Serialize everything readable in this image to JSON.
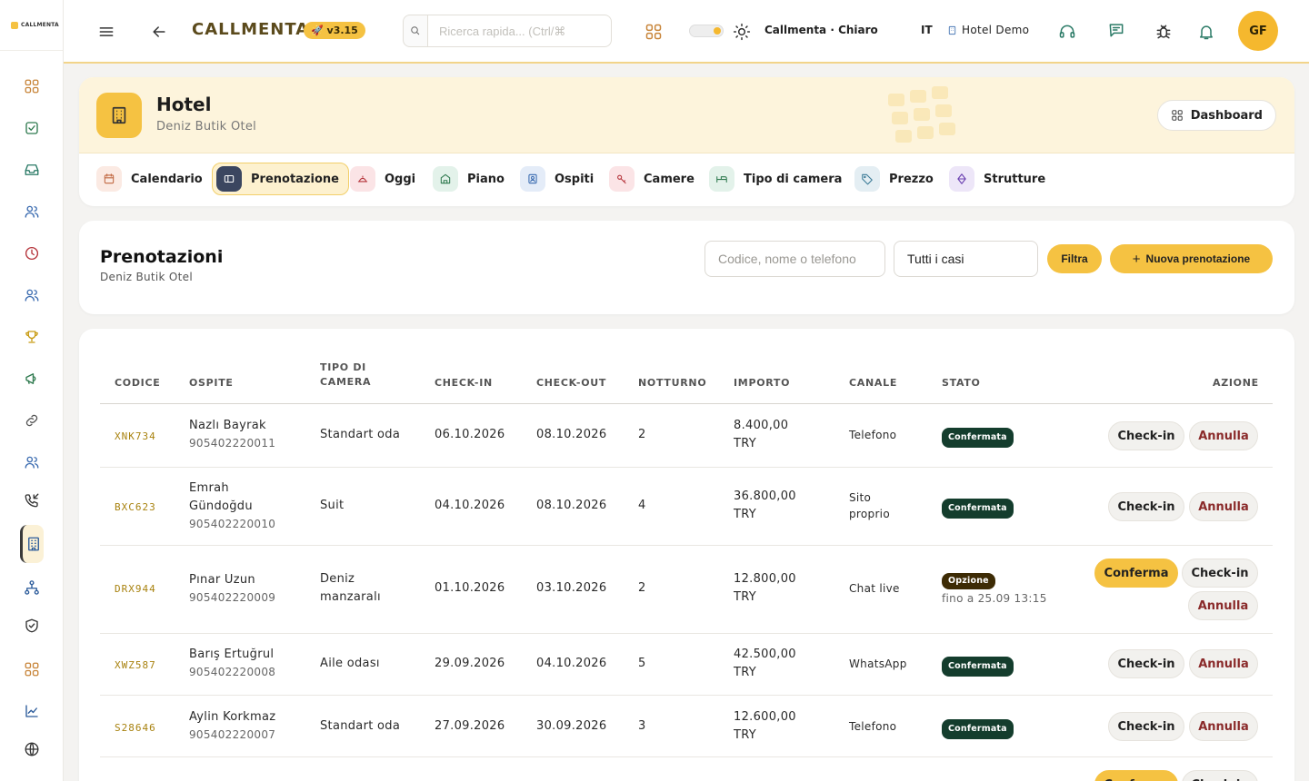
{
  "app": {
    "logo_text": "CALLMENTA",
    "brand": "CALLMENTA",
    "version": "🚀 v3.15",
    "search_placeholder": "Ricerca rapida... (Ctrl/⌘",
    "theme_label": "Callmenta · Chiaro",
    "language": "IT",
    "hotel_name": "Hotel Demo",
    "user_initials": "GF",
    "accent_color": "#f5c242"
  },
  "sidebar": {
    "items": [
      {
        "icon": "grid-icon"
      },
      {
        "icon": "calendar-check-icon"
      },
      {
        "icon": "inbox-icon"
      },
      {
        "icon": "users-icon"
      },
      {
        "icon": "clock-icon"
      },
      {
        "icon": "users-icon"
      },
      {
        "icon": "trophy-icon"
      },
      {
        "icon": "megaphone-icon"
      },
      {
        "icon": "link-icon"
      },
      {
        "icon": "users-icon"
      },
      {
        "icon": "phone-incoming-icon"
      },
      {
        "icon": "building-icon",
        "active": true
      },
      {
        "icon": "hierarchy-icon"
      },
      {
        "icon": "shield-check-icon"
      },
      {
        "icon": "grid-icon"
      },
      {
        "icon": "chart-icon"
      },
      {
        "icon": "globe-icon"
      }
    ]
  },
  "hotel": {
    "title": "Hotel",
    "subtitle": "Deniz Butik Otel",
    "dashboard_label": "Dashboard",
    "tabs": [
      {
        "label": "Calendario",
        "icon": "calendar-icon"
      },
      {
        "label": "Prenotazione",
        "icon": "booking-icon",
        "active": true
      },
      {
        "label": "Oggi",
        "icon": "bell-service-icon"
      },
      {
        "label": "Piano",
        "icon": "floor-icon"
      },
      {
        "label": "Ospiti",
        "icon": "guest-icon"
      },
      {
        "label": "Camere",
        "icon": "key-icon"
      },
      {
        "label": "Tipo di camera",
        "icon": "bed-icon"
      },
      {
        "label": "Prezzo",
        "icon": "tag-icon"
      },
      {
        "label": "Strutture",
        "icon": "gem-icon"
      }
    ]
  },
  "bookings": {
    "title": "Prenotazioni",
    "subtitle": "Deniz Butik Otel",
    "search_placeholder": "Codice, nome o telefono",
    "status_filter": "Tutti i casi",
    "filter_label": "Filtra",
    "new_label": "Nuova prenotazione"
  },
  "table": {
    "headers": {
      "code": "CODICE",
      "guest": "OSPITE",
      "room_type_1": "TIPO DI",
      "room_type_2": "CAMERA",
      "checkin": "CHECK-IN",
      "checkout": "CHECK-OUT",
      "nights": "NOTTURNO",
      "amount": "IMPORTO",
      "channel": "CANALE",
      "status": "STATO",
      "action": "AZIONE"
    },
    "rows": [
      {
        "code": "XNK734",
        "guest_1": "Nazlı Bayrak",
        "guest_2": "",
        "phone": "905402220011",
        "room_1": "Standart oda",
        "room_2": "",
        "checkin": "06.10.2026",
        "checkout": "08.10.2026",
        "nights": "2",
        "amount_1": "8.400,00",
        "amount_2": "TRY",
        "channel_1": "Telefono",
        "channel_2": "",
        "status": "Confermata",
        "until": "",
        "a1": "Check-in",
        "a2": "Annulla"
      },
      {
        "code": "BXC623",
        "guest_1": "Emrah",
        "guest_2": "Gündoğdu",
        "phone": "905402220010",
        "room_1": "Suit",
        "room_2": "",
        "checkin": "04.10.2026",
        "checkout": "08.10.2026",
        "nights": "4",
        "amount_1": "36.800,00",
        "amount_2": "TRY",
        "channel_1": "Sito",
        "channel_2": "proprio",
        "status": "Confermata",
        "until": "",
        "a1": "Check-in",
        "a2": "Annulla"
      },
      {
        "code": "DRX944",
        "guest_1": "Pınar Uzun",
        "guest_2": "",
        "phone": "905402220009",
        "room_1": "Deniz",
        "room_2": "manzaralı",
        "checkin": "01.10.2026",
        "checkout": "03.10.2026",
        "nights": "2",
        "amount_1": "12.800,00",
        "amount_2": "TRY",
        "channel_1": "Chat live",
        "channel_2": "",
        "status": "Opzione",
        "until": "fino a 25.09 13:15",
        "a0": "Conferma",
        "a1": "Check-in",
        "a2": "Annulla"
      },
      {
        "code": "XWZ587",
        "guest_1": "Barış Ertuğrul",
        "guest_2": "",
        "phone": "905402220008",
        "room_1": "Aile odası",
        "room_2": "",
        "checkin": "29.09.2026",
        "checkout": "04.10.2026",
        "nights": "5",
        "amount_1": "42.500,00",
        "amount_2": "TRY",
        "channel_1": "WhatsApp",
        "channel_2": "",
        "status": "Confermata",
        "until": "",
        "a1": "Check-in",
        "a2": "Annulla"
      },
      {
        "code": "S28646",
        "guest_1": "Aylin Korkmaz",
        "guest_2": "",
        "phone": "905402220007",
        "room_1": "Standart oda",
        "room_2": "",
        "checkin": "27.09.2026",
        "checkout": "30.09.2026",
        "nights": "3",
        "amount_1": "12.600,00",
        "amount_2": "TRY",
        "channel_1": "Telefono",
        "channel_2": "",
        "status": "Confermata",
        "until": "",
        "a1": "Check-in",
        "a2": "Annulla"
      }
    ],
    "partial_row": {
      "a0": "Conferma",
      "a1": "Check-in"
    }
  }
}
